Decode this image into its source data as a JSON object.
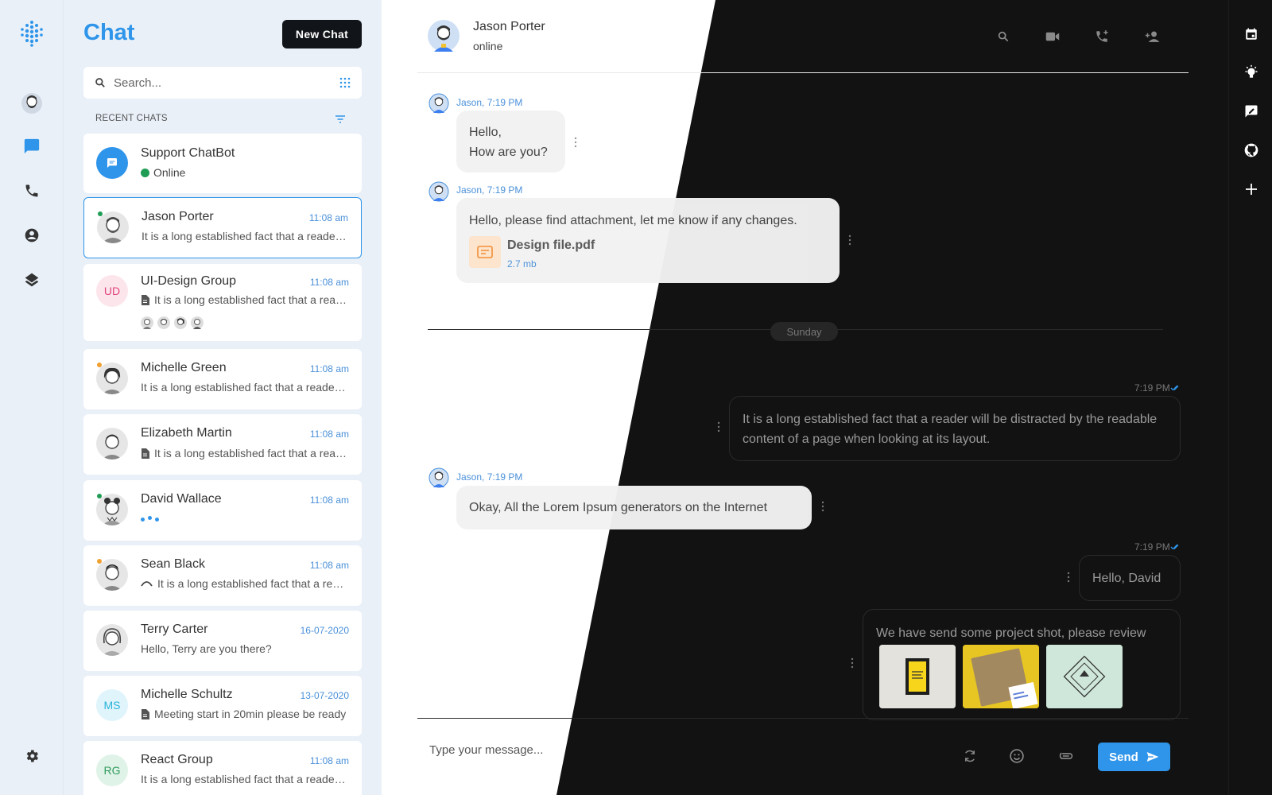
{
  "rail": {
    "logo_icon": "grid-dots-logo-icon",
    "items": [
      {
        "icon": "user-avatar-icon"
      },
      {
        "icon": "chat-icon",
        "active": true
      },
      {
        "icon": "phone-icon"
      },
      {
        "icon": "contacts-icon"
      },
      {
        "icon": "layers-icon"
      }
    ],
    "bottom": [
      {
        "icon": "moon-icon"
      },
      {
        "icon": "gear-icon"
      }
    ]
  },
  "list": {
    "title": "Chat",
    "new_chat_label": "New Chat",
    "search_placeholder": "Search...",
    "recent_label": "RECENT CHATS",
    "chats": [
      {
        "name": "Support ChatBot",
        "status": "Online",
        "time": "",
        "message": ""
      },
      {
        "name": "Jason Porter",
        "time": "11:08 am",
        "message": "It is a long established fact that a reader will be distracted",
        "online": true
      },
      {
        "name": "UI-Design Group",
        "initials": "UD",
        "time": "11:08 am",
        "message": "It is a long established fact that a reader will be distracted",
        "attachment": true
      },
      {
        "name": "Michelle Green",
        "time": "11:08 am",
        "message": "It is a long established fact that a reader will be distracted",
        "away": true
      },
      {
        "name": "Elizabeth Martin",
        "time": "11:08 am",
        "message": "It is a long established fact that a reader will be distracted",
        "attachment": true
      },
      {
        "name": "David Wallace",
        "time": "11:08 am",
        "message": "",
        "typing": true,
        "online": true
      },
      {
        "name": "Sean Black",
        "time": "11:08 am",
        "message": "It is a long established fact that a reader will be distracted",
        "away": true,
        "missed_call": true
      },
      {
        "name": "Terry Carter",
        "time": "16-07-2020",
        "message": "Hello, Terry are you there?"
      },
      {
        "name": "Michelle Schultz",
        "initials": "MS",
        "time": "13-07-2020",
        "message": "Meeting start in 20min please be ready",
        "attachment": true
      },
      {
        "name": "React Group",
        "initials": "RG",
        "time": "11:08 am",
        "message": "It is a long established fact that a reader will be distracted"
      }
    ]
  },
  "conversation": {
    "contact_name": "Jason Porter",
    "contact_status": "online",
    "header_icons": [
      "search-icon",
      "video-icon",
      "phone-add-icon",
      "person-add-icon"
    ],
    "messages": {
      "m1_meta": "Jason, 7:19 PM",
      "m1_line1": "Hello,",
      "m1_line2": "How are you?",
      "m2_meta": "Jason, 7:19 PM",
      "m2_text": "Hello, please find attachment, let me know if any changes.",
      "m2_file_name": "Design file.pdf",
      "m2_file_size": "2.7 mb",
      "day_divider": "Sunday",
      "m3_meta": "7:19 PM",
      "m3_text": "It is a long established fact that a reader will be distracted by the readable content of a page when looking at its layout.",
      "m4_meta": "Jason, 7:19 PM",
      "m4_text": "Okay, All the Lorem Ipsum generators on the Internet",
      "m5_meta": "7:19 PM",
      "m5_text": "Hello, David",
      "m6_text": "We have send some project shot, please review"
    },
    "input_placeholder": "Type your message...",
    "send_label": "Send"
  },
  "right_rail": {
    "icons": [
      "calendar-icon",
      "bulb-icon",
      "edit-chat-icon",
      "github-icon",
      "plus-icon"
    ]
  },
  "colors": {
    "accent": "#2f95ea",
    "dark": "#121212",
    "online": "#1f9d55",
    "away": "#f0a030"
  }
}
